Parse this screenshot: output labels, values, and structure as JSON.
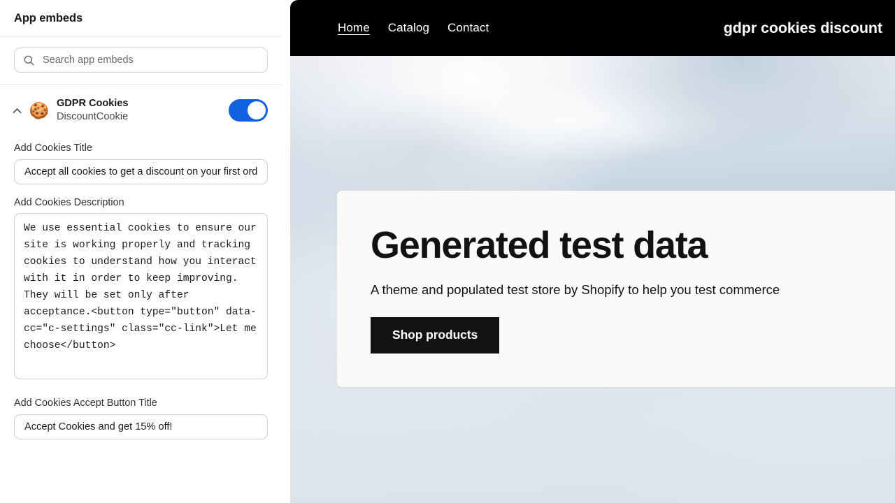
{
  "sidebar": {
    "title": "App embeds",
    "search": {
      "placeholder": "Search app embeds",
      "value": "",
      "icon": "search-icon"
    },
    "embed": {
      "collapse_icon": "chevron-up-icon",
      "app_icon": "cookie-icon",
      "name": "GDPR Cookies",
      "subtitle": "DiscountCookie",
      "toggle_enabled": "true",
      "toggle_color": "#1160e0"
    },
    "fields": [
      {
        "label": "Add Cookies Title",
        "type": "input",
        "value": "Accept all cookies to get a discount on your first order!"
      },
      {
        "label": "Add Cookies Description",
        "type": "textarea",
        "value": "We use essential cookies to ensure our site is working properly and tracking cookies to understand how you interact with it in order to keep improving. They will be set only after acceptance.<button type=\"button\" data-cc=\"c-settings\" class=\"cc-link\">Let me choose</button>"
      },
      {
        "label": "Add Cookies Accept Button Title",
        "type": "input",
        "value": "Accept Cookies and get 15% off!"
      }
    ]
  },
  "preview": {
    "nav": {
      "links": [
        {
          "label": "Home",
          "active": "true"
        },
        {
          "label": "Catalog",
          "active": "false"
        },
        {
          "label": "Contact",
          "active": "false"
        }
      ],
      "brand": "gdpr cookies discount",
      "background_color": "#000000"
    },
    "hero": {
      "heading": "Generated test data",
      "subheading": "A theme and populated test store by Shopify to help you test commerce",
      "button_label": "Shop products",
      "card_background": "#fafaf8",
      "button_background": "#121212"
    }
  }
}
